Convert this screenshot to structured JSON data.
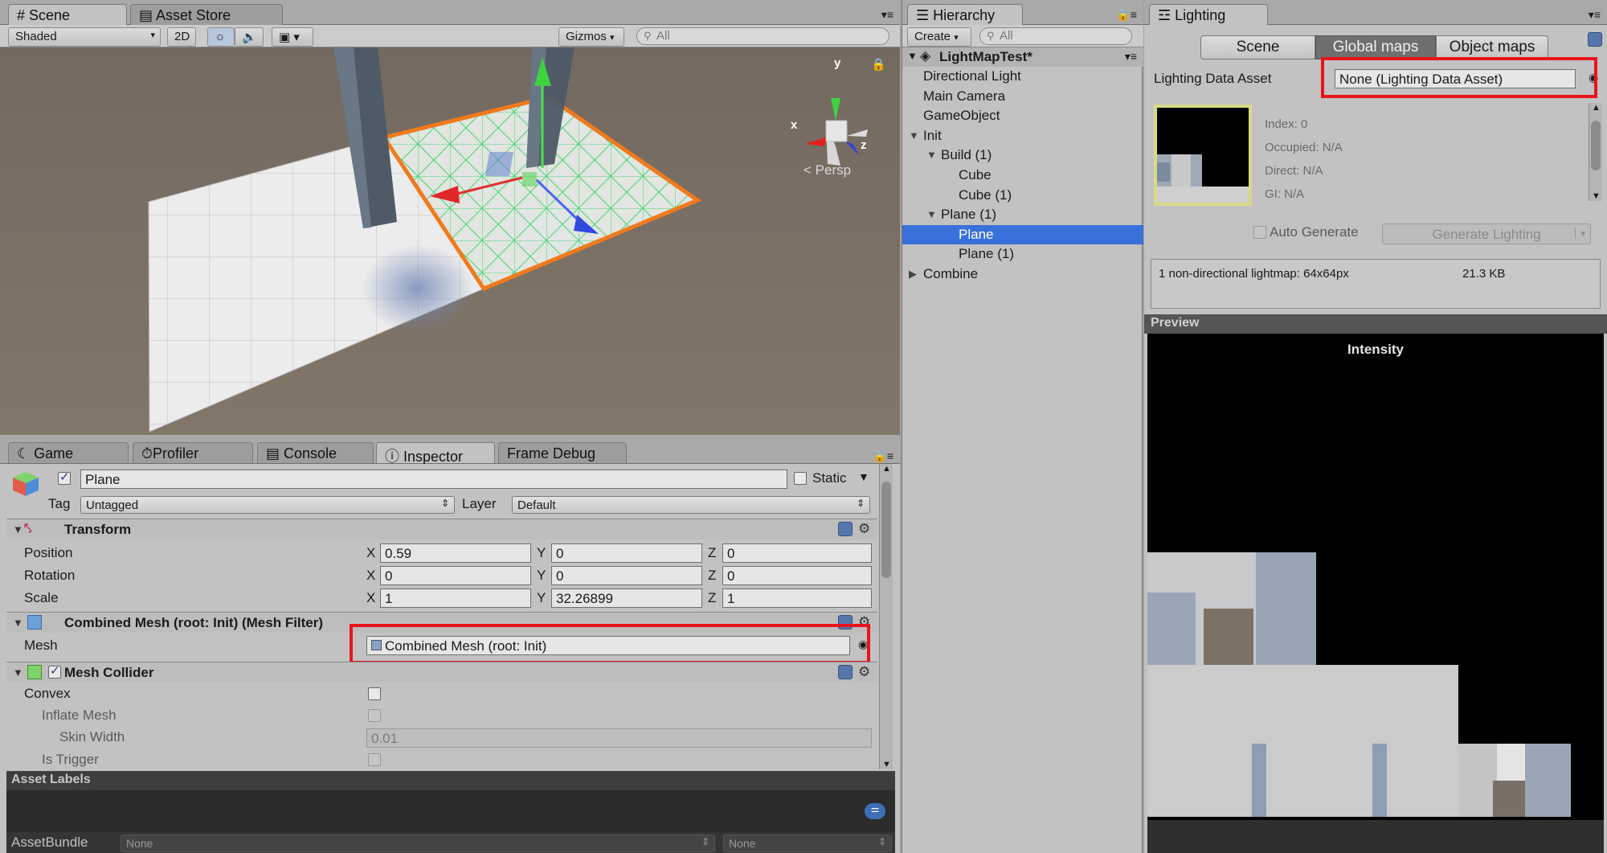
{
  "scene_panel": {
    "tabs": [
      {
        "label": "Scene",
        "icon": "grid-icon"
      },
      {
        "label": "Asset Store",
        "icon": "store-icon"
      }
    ],
    "toolbar": {
      "shading_mode": "Shaded",
      "mode_2d": "2D",
      "gizmos": "Gizmos",
      "search_placeholder": "All"
    },
    "persp_label": "Persp",
    "gizmo_axes": {
      "x": "x",
      "y": "y",
      "z": "z"
    }
  },
  "bottom_tabs": [
    {
      "label": "Game",
      "icon": "game-icon"
    },
    {
      "label": "Profiler",
      "icon": "profiler-icon"
    },
    {
      "label": "Console",
      "icon": "console-icon"
    },
    {
      "label": "Inspector",
      "icon": "info-icon"
    },
    {
      "label": "Frame Debug",
      "icon": ""
    }
  ],
  "inspector": {
    "object_name": "Plane",
    "active": true,
    "static_label": "Static",
    "static": false,
    "tag_label": "Tag",
    "tag_value": "Untagged",
    "layer_label": "Layer",
    "layer_value": "Default",
    "transform": {
      "title": "Transform",
      "position": {
        "label": "Position",
        "x": "0.59",
        "y": "0",
        "z": "0"
      },
      "rotation": {
        "label": "Rotation",
        "x": "0",
        "y": "0",
        "z": "0"
      },
      "scale": {
        "label": "Scale",
        "x": "1",
        "y": "32.26899",
        "z": "1"
      },
      "axis_x": "X",
      "axis_y": "Y",
      "axis_z": "Z"
    },
    "mesh_filter": {
      "title": "Combined Mesh (root: Init) (Mesh Filter)",
      "mesh_label": "Mesh",
      "mesh_value": "Combined Mesh (root: Init)"
    },
    "mesh_collider": {
      "title": "Mesh Collider",
      "enabled": true,
      "convex_label": "Convex",
      "convex": false,
      "inflate_label": "Inflate Mesh",
      "skin_label": "Skin Width",
      "skin_value": "0.01",
      "trigger_label": "Is Trigger"
    },
    "asset_labels": "Asset Labels",
    "assetbundle_label": "AssetBundle",
    "assetbundle_value": "None",
    "assetbundle_variant": "None"
  },
  "hierarchy": {
    "tab_label": "Hierarchy",
    "create_label": "Create",
    "search_placeholder": "All",
    "scene_name": "LightMapTest*",
    "items": [
      {
        "label": "Directional Light",
        "depth": 1,
        "expand": ""
      },
      {
        "label": "Main Camera",
        "depth": 1,
        "expand": ""
      },
      {
        "label": "GameObject",
        "depth": 1,
        "expand": ""
      },
      {
        "label": "Init",
        "depth": 1,
        "expand": "open"
      },
      {
        "label": "Build (1)",
        "depth": 2,
        "expand": "open"
      },
      {
        "label": "Cube",
        "depth": 3,
        "expand": ""
      },
      {
        "label": "Cube (1)",
        "depth": 3,
        "expand": ""
      },
      {
        "label": "Plane (1)",
        "depth": 2,
        "expand": "open"
      },
      {
        "label": "Plane",
        "depth": 3,
        "expand": "",
        "selected": true
      },
      {
        "label": "Plane (1)",
        "depth": 3,
        "expand": ""
      },
      {
        "label": "Combine",
        "depth": 1,
        "expand": "closed"
      }
    ]
  },
  "lighting": {
    "tab_label": "Lighting",
    "mode_tabs": [
      "Scene",
      "Global maps",
      "Object maps"
    ],
    "active_mode": "Global maps",
    "data_asset_label": "Lighting Data Asset",
    "data_asset_value": "None (Lighting Data Asset)",
    "lightmap_info": [
      "Index: 0",
      "Occupied: N/A",
      "Direct: N/A",
      "GI: N/A"
    ],
    "auto_generate_label": "Auto Generate",
    "auto_generate": false,
    "generate_label": "Generate Lighting",
    "summary_text": "1 non-directional lightmap: 64x64px",
    "summary_size": "21.3 KB",
    "preview_label": "Preview",
    "preview_title": "Intensity"
  }
}
